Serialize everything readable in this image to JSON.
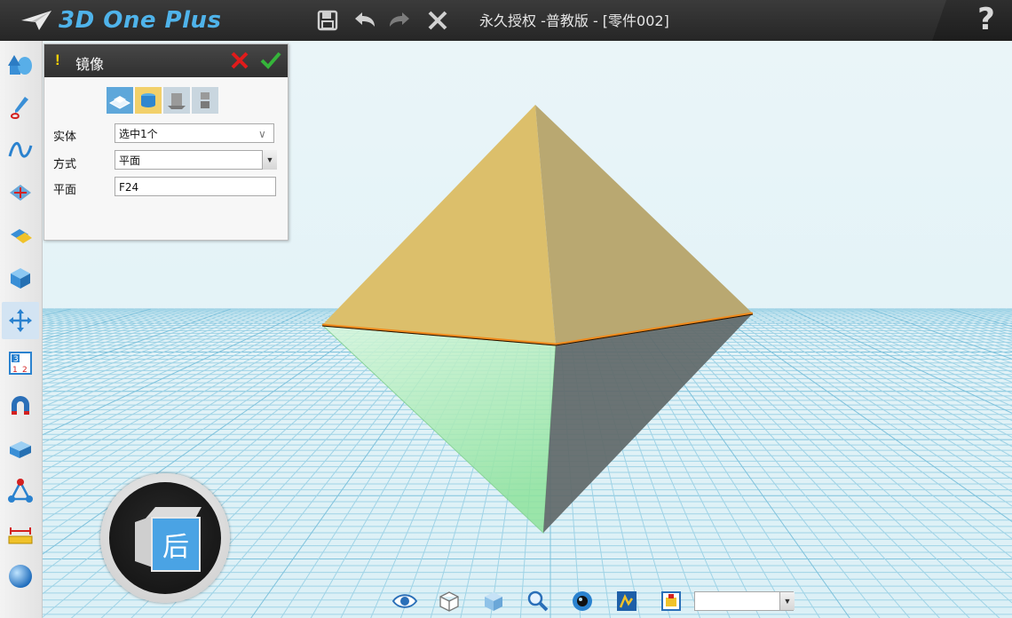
{
  "app": {
    "logo_text": "3D One Plus",
    "document_title": "永久授权 -普教版 - [零件002]",
    "help_label": "?"
  },
  "titlebar": {
    "icons": [
      "save-icon",
      "undo-icon",
      "redo-icon",
      "close-icon"
    ]
  },
  "left_toolbar": {
    "items": [
      {
        "icon": "basic-solid-icon"
      },
      {
        "icon": "sketch-icon"
      },
      {
        "icon": "curve-icon"
      },
      {
        "icon": "special-function-icon"
      },
      {
        "icon": "combine-icon"
      },
      {
        "icon": "feature-modify-icon"
      },
      {
        "icon": "basic-edit-icon",
        "active": true
      },
      {
        "icon": "auto-snap-icon"
      },
      {
        "icon": "magnet-icon"
      },
      {
        "icon": "group-icon"
      },
      {
        "icon": "distance-measure-icon"
      },
      {
        "icon": "ruler-icon"
      },
      {
        "icon": "material-render-icon"
      }
    ]
  },
  "mirror_panel": {
    "warning": "!",
    "title": "镜像",
    "mode_buttons": [
      "mirror-mode-1",
      "mirror-mode-2",
      "mirror-mode-3",
      "mirror-mode-4"
    ],
    "fields": {
      "entity": {
        "label": "实体",
        "value": "选中1个"
      },
      "method": {
        "label": "方式",
        "value": "平面"
      },
      "plane": {
        "label": "平面",
        "value": "F24"
      }
    }
  },
  "viewcube": {
    "face_label": "后"
  },
  "bottom_toolbar": {
    "icons": [
      "view-eye-icon",
      "wireframe-cube-icon",
      "shaded-cube-icon",
      "zoom-icon",
      "camera-icon",
      "render-icon",
      "material-icon"
    ],
    "select_value": ""
  },
  "colors": {
    "accent": "#4aa3e4",
    "pyramid_top_left": "#dcbf6b",
    "pyramid_top_right": "#b9a871",
    "mirror_green": "#9fe8a8",
    "mirror_dark": "#5c6666",
    "edge_highlight": "#f08a1c"
  }
}
